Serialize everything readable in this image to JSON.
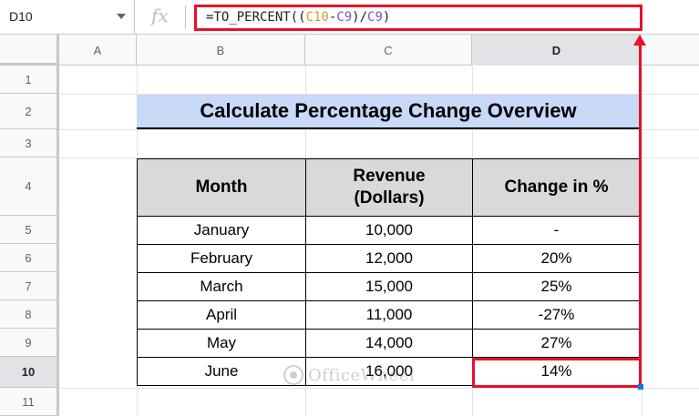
{
  "name_box": {
    "value": "D10"
  },
  "formula_bar": {
    "fx_label": "fx",
    "parts": [
      "=TO_PERCENT((",
      "C10",
      "-",
      "C9",
      ")/",
      "C9",
      ")"
    ]
  },
  "columns": [
    "A",
    "B",
    "C",
    "D"
  ],
  "rows": [
    "1",
    "2",
    "3",
    "4",
    "5",
    "6",
    "7",
    "8",
    "9",
    "10",
    "11"
  ],
  "sheet": {
    "title": "Calculate Percentage Change Overview",
    "headers": {
      "month": "Month",
      "revenue_line1": "Revenue",
      "revenue_line2": "(Dollars)",
      "change": "Change in %"
    },
    "records": [
      {
        "month": "January",
        "revenue": "10,000",
        "change": "-"
      },
      {
        "month": "February",
        "revenue": "12,000",
        "change": "20%"
      },
      {
        "month": "March",
        "revenue": "15,000",
        "change": "25%"
      },
      {
        "month": "April",
        "revenue": "11,000",
        "change": "-27%"
      },
      {
        "month": "May",
        "revenue": "14,000",
        "change": "27%"
      },
      {
        "month": "June",
        "revenue": "16,000",
        "change": "14%"
      }
    ]
  },
  "watermark": {
    "text": "OfficeWheel"
  },
  "colors": {
    "highlight": "#e8102a",
    "ref_c10": "#d79a1f",
    "ref_c9": "#7d52c9",
    "title_fill": "#c9daf8",
    "header_fill": "#d9d9d9"
  }
}
